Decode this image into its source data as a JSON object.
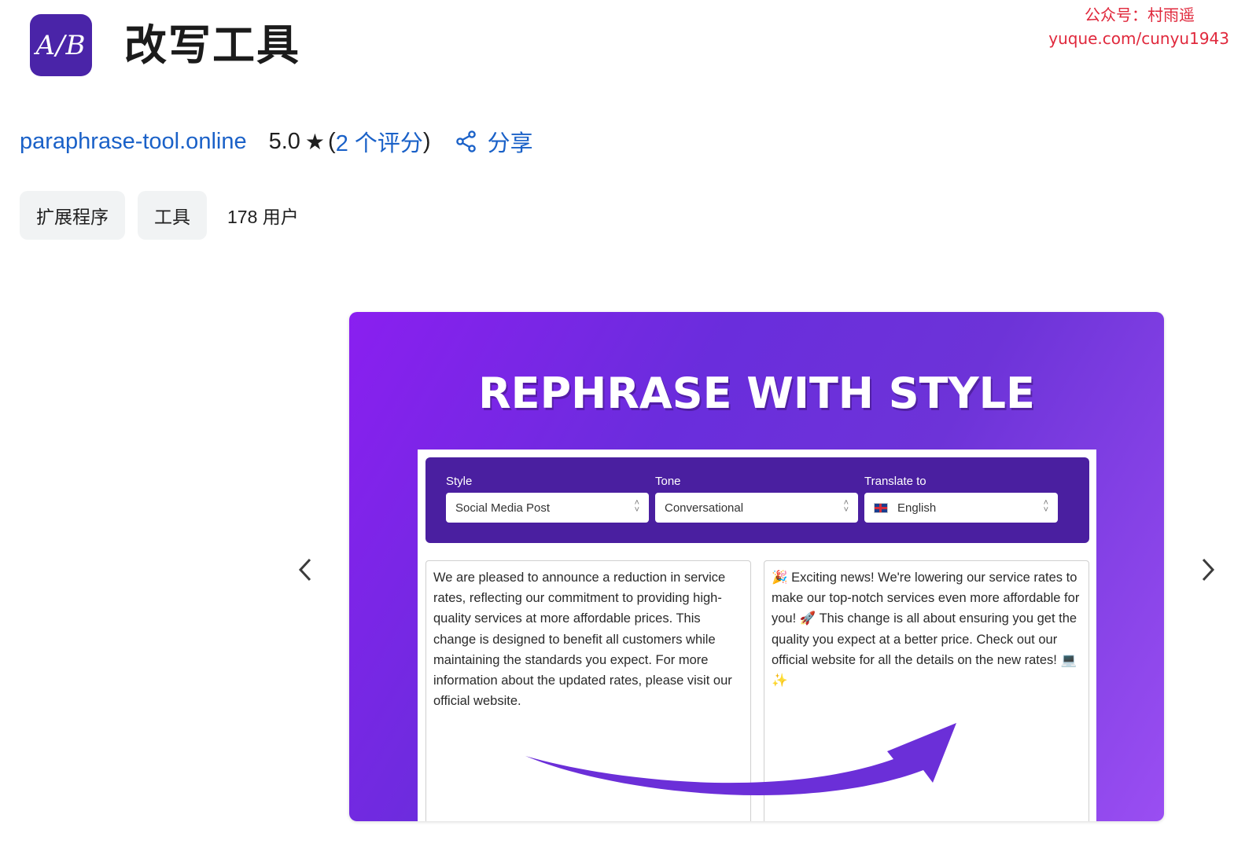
{
  "watermark": {
    "line1": "公众号：村雨遥",
    "line2": "yuque.com/cunyu1943"
  },
  "app": {
    "logo_text": "A/B",
    "title": "改写工具"
  },
  "meta": {
    "site": "paraphrase-tool.online",
    "rating": "5.0",
    "rating_stars": 5.0,
    "reviews_open": "(",
    "reviews": "2 个评分",
    "reviews_close": ")",
    "share_label": "分享"
  },
  "chips": {
    "type": "扩展程序",
    "category": "工具",
    "users": "178 用户"
  },
  "promo": {
    "headline": "REPHRASE WITH STYLE",
    "controls": [
      {
        "label": "Style",
        "value": "Social Media Post"
      },
      {
        "label": "Tone",
        "value": "Conversational"
      },
      {
        "label": "Translate to",
        "value": "English"
      }
    ],
    "input_text": "We are pleased to announce a reduction in service rates, reflecting our commitment to providing high-quality services at more affordable prices. This change is designed to benefit all customers while maintaining the standards you expect. For more information about the updated rates, please visit our official website.",
    "output_text": "🎉 Exciting news! We're lowering our service rates to make our top-notch services even more affordable for you! 🚀 This change is all about ensuring you get the quality you expect at a better price. Check out our official website for all the details on the new rates! 💻 ✨"
  },
  "colors": {
    "link": "#1a61c8",
    "logo_bg": "#4a24a8",
    "promo_purple": "#6a2ddc",
    "control_bar": "#4a1fa0",
    "watermark": "#e0283c"
  }
}
